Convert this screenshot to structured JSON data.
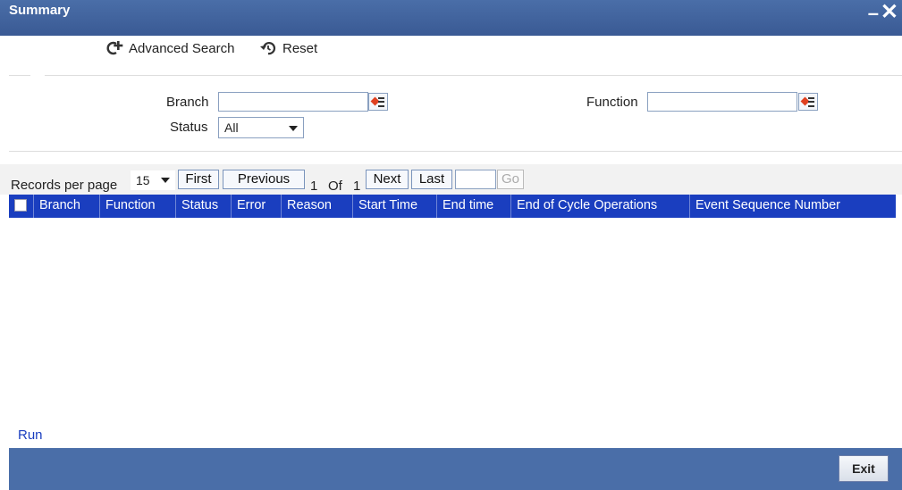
{
  "window": {
    "title": "Summary"
  },
  "toolbar": {
    "advanced_search": "Advanced Search",
    "reset": "Reset"
  },
  "search": {
    "branch_label": "Branch",
    "branch_value": "",
    "function_label": "Function",
    "function_value": "",
    "status_label": "Status",
    "status_value": "All"
  },
  "pager": {
    "records_per_page_label": "Records per page",
    "records_per_page_value": "15",
    "first": "First",
    "previous": "Previous",
    "current_page": "1",
    "of_label": "Of",
    "total_pages": "1",
    "next": "Next",
    "last": "Last",
    "goto_value": "",
    "go": "Go"
  },
  "grid": {
    "columns": [
      "Branch",
      "Function",
      "Status",
      "Error",
      "Reason",
      "Start Time",
      "End time",
      "End of Cycle Operations",
      "Event Sequence Number"
    ],
    "rows": []
  },
  "actions": {
    "run": "Run",
    "exit": "Exit"
  },
  "colors": {
    "titlebar": "#4a6ea8",
    "grid_header": "#1a3ebf",
    "link": "#1a3ebf"
  },
  "icons": [
    "advanced-search-icon",
    "reset-icon",
    "lov-icon",
    "minimize-icon",
    "close-icon"
  ]
}
